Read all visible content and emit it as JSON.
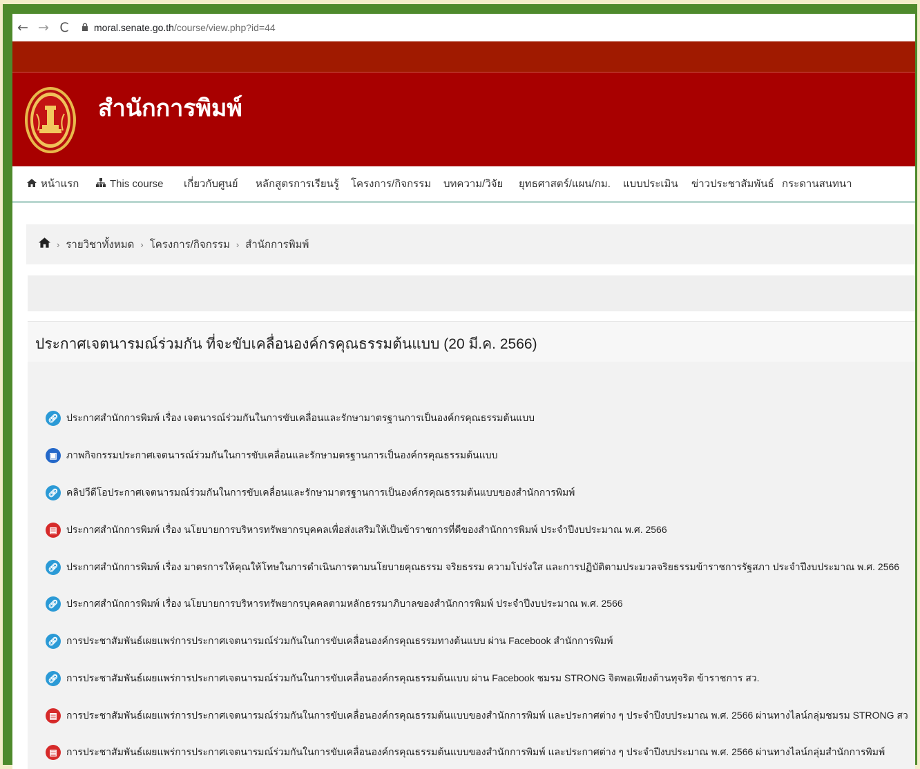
{
  "browser": {
    "back": "←",
    "forward": "→",
    "reload": "C",
    "url_host": "moral.senate.go.th",
    "url_path": "/course/view.php?id=44"
  },
  "header": {
    "site_title": "สำนักการพิมพ์"
  },
  "menu": {
    "items": [
      {
        "label": "หน้าแรก",
        "icon": "home-icon"
      },
      {
        "label": "This course",
        "icon": "sitemap-icon"
      },
      {
        "label": "เกี่ยวกับศูนย์"
      },
      {
        "label": "หลักสูตรการเรียนรู้"
      },
      {
        "label": "โครงการ/กิจกรรม"
      },
      {
        "label": "บทความ/วิจัย"
      },
      {
        "label": "ยุทธศาสตร์/แผน/กม."
      },
      {
        "label": "แบบประเมิน"
      },
      {
        "label": "ข่าวประชาสัมพันธ์"
      },
      {
        "label": "กระดานสนทนา"
      }
    ]
  },
  "breadcrumb": {
    "items": [
      "รายวิชาทั้งหมด",
      "โครงการ/กิจกรรม",
      "สำนักการพิมพ์"
    ],
    "separator": "›"
  },
  "section": {
    "title": "ประกาศเจตนารมณ์ร่วมกัน ที่จะขับเคลื่อนองค์กรคุณธรรมต้นแบบ (20 มี.ค. 2566)",
    "items": [
      {
        "type": "link",
        "text": "ประกาศสำนักการพิมพ์ เรื่อง เจตนารณ์ร่วมกันในการขับเคลื่อนและรักษามาตรฐานการเป็นองค์กรคุณธรรมต้นแบบ"
      },
      {
        "type": "image",
        "text": "ภาพกิจกรรมประกาศเจตนารณ์ร่วมกันในการขับเคลื่อนและรักษามตรฐานการเป็นองค์กรคุณธรรมต้นแบบ"
      },
      {
        "type": "link",
        "text": "คลิปวีดีโอประกาศเจตนารมณ์ร่วมกันในการขับเคลื่อนและรักษามาตรฐานการเป็นองค์กรคุณธรรมต้นแบบของสำนักการพิมพ์"
      },
      {
        "type": "pdf",
        "text": "ประกาศสำนักการพิมพ์ เรื่อง นโยบายการบริหารทรัพยากรบุคคลเพื่อส่งเสริมให้เป็นข้าราชการที่ดีของสำนักการพิมพ์ ประจำปีงบประมาณ พ.ศ. 2566"
      },
      {
        "type": "link",
        "text": "ประกาศสำนักการพิมพ์ เรื่อง มาตรการให้คุณให้โทษในการดำเนินการตามนโยบายคุณธรรม จริยธรรม ความโปร่งใส และการปฏิบัติตามประมวลจริยธรรมข้าราชการรัฐสภา ประจำปีงบประมาณ พ.ศ. 2566"
      },
      {
        "type": "link",
        "text": "ประกาศสำนักการพิมพ์ เรื่อง นโยบายการบริหารทรัพยากรบุคคลตามหลักธรรมาภิบาลของสำนักการพิมพ์ ประจำปีงบประมาณ พ.ศ. 2566"
      },
      {
        "type": "link",
        "text": "การประชาสัมพันธ์เผยแพร่การประกาศเจตนารมณ์ร่วมกันในการขับเคลื่อนองค์กรคุณธรรมทางต้นแบบ ผ่าน Facebook สำนักการพิมพ์"
      },
      {
        "type": "link",
        "text": "การประชาสัมพันธ์เผยแพร่การประกาศเจตนารมณ์ร่วมกันในการขับเคลื่อนองค์กรคุณธรรมต้นแบบ ผ่าน Facebook ชมรม STRONG จิตพอเพียงต้านทุจริต ข้าราชการ สว."
      },
      {
        "type": "pdf",
        "text": "การประชาสัมพันธ์เผยแพร่การประกาศเจตนารมณ์ร่วมกันในการขับเคลื่อนองค์กรคุณธรรมต้นแบบของสำนักการพิมพ์ และประกาศต่าง ๆ ประจำปีงบประมาณ พ.ศ. 2566 ผ่านทางไลน์กลุ่มชมรม STRONG สว"
      },
      {
        "type": "pdf",
        "text": "การประชาสัมพันธ์เผยแพร่การประกาศเจตนารมณ์ร่วมกันในการขับเคลื่อนองค์กรคุณธรรมต้นแบบของสำนักการพิมพ์ และประกาศต่าง ๆ ประจำปีงบประมาณ พ.ศ. 2566 ผ่านทางไลน์กลุ่มสำนักการพิมพ์"
      }
    ]
  }
}
